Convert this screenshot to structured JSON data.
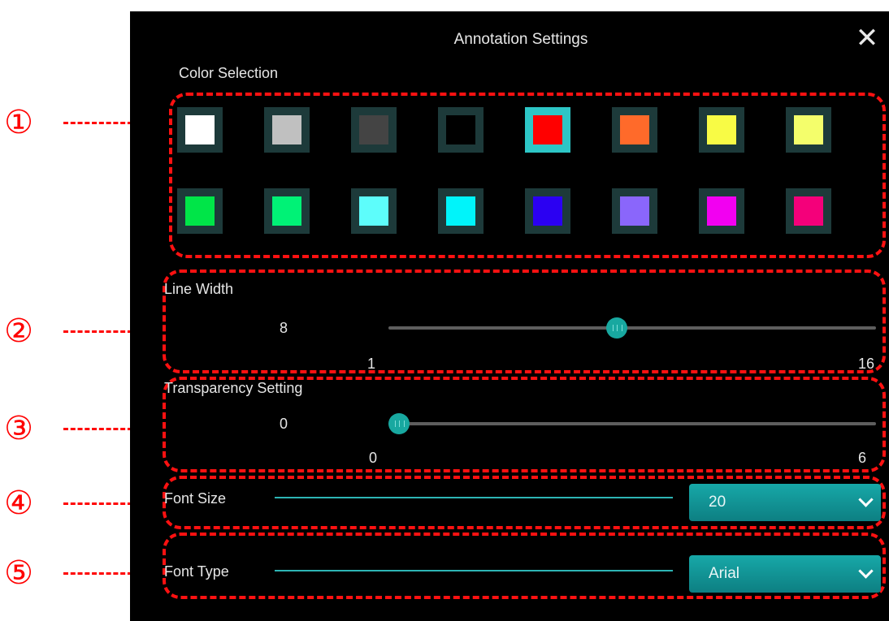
{
  "callouts": [
    "①",
    "②",
    "③",
    "④",
    "⑤"
  ],
  "dialog": {
    "title": "Annotation Settings",
    "close_icon": "close-icon"
  },
  "color_selection": {
    "label": "Color Selection",
    "colors": [
      "#ffffff",
      "#c0c0c0",
      "#444444",
      "#000000",
      "#ff0000",
      "#ff6a2a",
      "#f8fb45",
      "#f4fe6b",
      "#00e548",
      "#00f276",
      "#5dfdfb",
      "#00f4fa",
      "#2b00f2",
      "#8a66fb",
      "#f200f1",
      "#f4007a"
    ],
    "selected_index": 4
  },
  "line_width": {
    "label": "Line Width",
    "value": "8",
    "min": "1",
    "max": "16"
  },
  "transparency": {
    "label": "Transparency Setting",
    "value": "0",
    "min": "0",
    "max": "6"
  },
  "font_size": {
    "label": "Font Size",
    "value": "20"
  },
  "font_type": {
    "label": "Font Type",
    "value": "Arial"
  }
}
